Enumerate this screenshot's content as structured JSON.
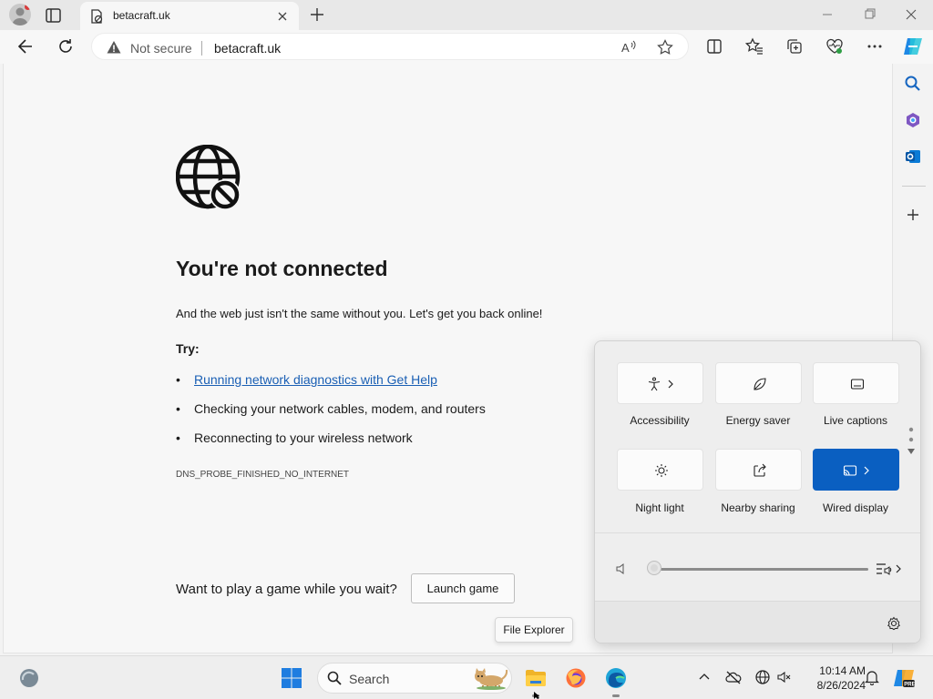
{
  "browser": {
    "tab_title": "betacraft.uk",
    "address": {
      "security_label": "Not secure",
      "url": "betacraft.uk"
    }
  },
  "page": {
    "heading": "You're not connected",
    "subtitle": "And the web just isn't the same without you. Let's get you back online!",
    "try_label": "Try:",
    "suggestions": [
      "Running network diagnostics with Get Help",
      "Checking your network cables, modem, and routers",
      "Reconnecting to your wireless network"
    ],
    "error_code": "DNS_PROBE_FINISHED_NO_INTERNET",
    "game_prompt": "Want to play a game while you wait?",
    "game_button": "Launch game"
  },
  "tooltip": "File Explorer",
  "quick_settings": {
    "tiles": [
      {
        "label": "Accessibility",
        "icon": "accessibility-icon",
        "active": false,
        "has_chevron": true
      },
      {
        "label": "Energy saver",
        "icon": "leaf-icon",
        "active": false,
        "has_chevron": false
      },
      {
        "label": "Live captions",
        "icon": "captions-icon",
        "active": false,
        "has_chevron": false
      },
      {
        "label": "Night light",
        "icon": "sun-icon",
        "active": false,
        "has_chevron": false
      },
      {
        "label": "Nearby sharing",
        "icon": "share-icon",
        "active": false,
        "has_chevron": false
      },
      {
        "label": "Wired display",
        "icon": "cast-icon",
        "active": true,
        "has_chevron": true
      }
    ],
    "volume_level": 0.0
  },
  "taskbar": {
    "search_placeholder": "Search",
    "time": "10:14 AM",
    "date": "8/26/2024"
  },
  "colors": {
    "accent": "#0a5fc1",
    "link": "#1a5fb4"
  }
}
